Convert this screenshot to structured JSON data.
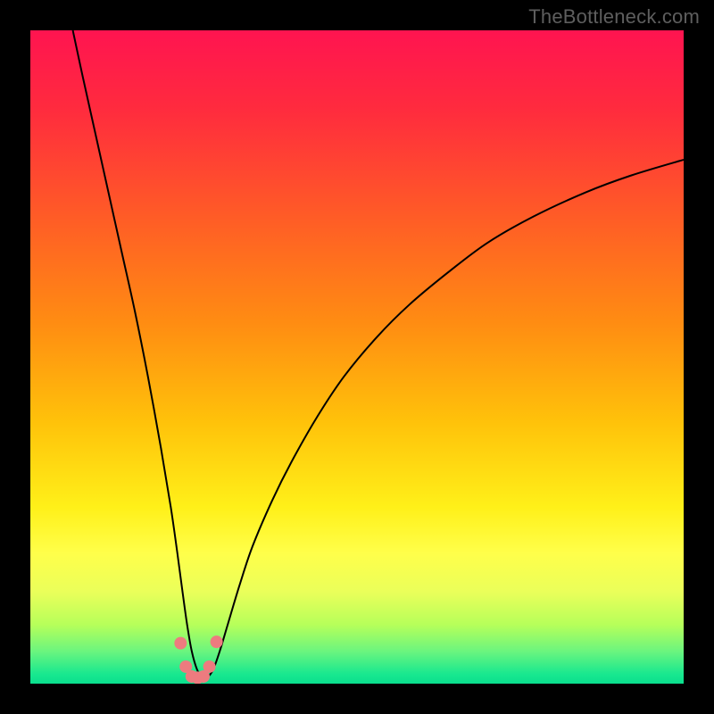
{
  "attribution": "TheBottleneck.com",
  "chart_data": {
    "type": "line",
    "title": "",
    "xlabel": "",
    "ylabel": "",
    "xlim": [
      0,
      100
    ],
    "ylim": [
      0,
      100
    ],
    "grid": false,
    "legend": false,
    "annotations": [],
    "background_gradient": {
      "stops": [
        {
          "pos": 0.0,
          "color": "#ff1450"
        },
        {
          "pos": 0.12,
          "color": "#ff2b3e"
        },
        {
          "pos": 0.28,
          "color": "#ff5a27"
        },
        {
          "pos": 0.45,
          "color": "#ff8d12"
        },
        {
          "pos": 0.6,
          "color": "#ffc20a"
        },
        {
          "pos": 0.73,
          "color": "#fff019"
        },
        {
          "pos": 0.8,
          "color": "#ffff4a"
        },
        {
          "pos": 0.86,
          "color": "#eaff5a"
        },
        {
          "pos": 0.91,
          "color": "#b6ff5a"
        },
        {
          "pos": 0.95,
          "color": "#6cf57e"
        },
        {
          "pos": 0.985,
          "color": "#19e88f"
        },
        {
          "pos": 1.0,
          "color": "#0adf8e"
        }
      ]
    },
    "series": [
      {
        "name": "bottleneck-curve",
        "color": "#000000",
        "width": 2,
        "x": [
          6.5,
          8,
          10,
          12,
          14,
          16,
          18,
          20,
          21.5,
          22.5,
          23.3,
          24.0,
          24.7,
          25.5,
          26.3,
          27.1,
          28.0,
          29.0,
          30.2,
          32,
          34,
          37,
          40,
          44,
          48,
          53,
          58,
          64,
          70,
          77,
          85,
          92,
          100
        ],
        "y": [
          100,
          93,
          84,
          75,
          66,
          57,
          47,
          36,
          27,
          20,
          14,
          9,
          5,
          2.2,
          1.0,
          1.0,
          2.2,
          5,
          9,
          15,
          21,
          28,
          34,
          41,
          47,
          53,
          58,
          63,
          67.5,
          71.5,
          75.2,
          77.8,
          80.2
        ]
      }
    ],
    "markers": {
      "color": "#ed7b7f",
      "radius": 7,
      "points": [
        {
          "x": 23.0,
          "y": 6.2
        },
        {
          "x": 23.8,
          "y": 2.6
        },
        {
          "x": 24.7,
          "y": 1.1
        },
        {
          "x": 25.6,
          "y": 0.9
        },
        {
          "x": 26.5,
          "y": 1.1
        },
        {
          "x": 27.4,
          "y": 2.6
        },
        {
          "x": 28.5,
          "y": 6.4
        }
      ]
    }
  }
}
